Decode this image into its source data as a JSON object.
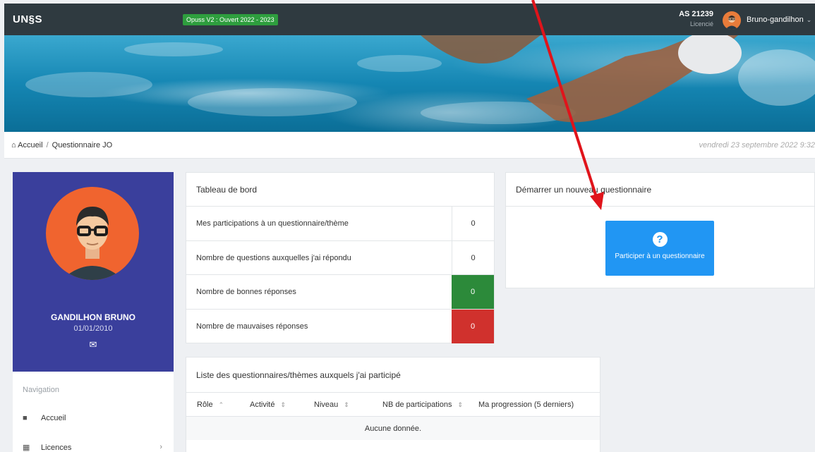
{
  "header": {
    "logo": "UN§S",
    "version_badge": "Opuss V2 : Ouvert 2022 - 2023",
    "as_code": "AS 21239",
    "as_role": "Licencié",
    "user_name": "Bruno-gandilhon",
    "chevron": "⌄"
  },
  "breadcrumb": {
    "home": "Accueil",
    "separator": "/",
    "current": "Questionnaire JO",
    "date": "vendredi 23 septembre 2022 9:32"
  },
  "profile": {
    "name": "GANDILHON BRUNO",
    "dob": "01/01/2010",
    "mail_icon": "✉"
  },
  "nav": {
    "title": "Navigation",
    "items": [
      {
        "label": "Accueil",
        "icon": "👤"
      },
      {
        "label": "Licences",
        "icon": "▦",
        "chevron": "›"
      }
    ]
  },
  "dashboard": {
    "title": "Tableau de bord",
    "rows": [
      {
        "label": "Mes participations à un questionnaire/thème",
        "value": "0"
      },
      {
        "label": "Nombre de questions auxquelles j'ai répondu",
        "value": "0"
      },
      {
        "label": "Nombre de bonnes réponses",
        "value": "0"
      },
      {
        "label": "Nombre de mauvaises réponses",
        "value": "0"
      }
    ]
  },
  "start": {
    "title": "Démarrer un nouveau questionnaire",
    "button_icon": "?",
    "button_label": "Participer à un questionnaire"
  },
  "list": {
    "title": "Liste des questionnaires/thèmes auxquels j'ai participé",
    "columns": [
      {
        "label": "Rôle",
        "sort": "⌃"
      },
      {
        "label": "Activité",
        "sort": "⇕"
      },
      {
        "label": "Niveau",
        "sort": "⇕"
      },
      {
        "label": "NB de participations",
        "sort": "⇕"
      },
      {
        "label": "Ma progression (5 derniers)",
        "sort": ""
      }
    ],
    "empty": "Aucune donnée."
  },
  "colors": {
    "topbar": "#2f3a40",
    "profile_bg": "#3a3f9c",
    "primary": "#2196f3",
    "success": "#2c8a3a",
    "danger": "#d0312d",
    "annotation_arrow": "#e0141b"
  }
}
